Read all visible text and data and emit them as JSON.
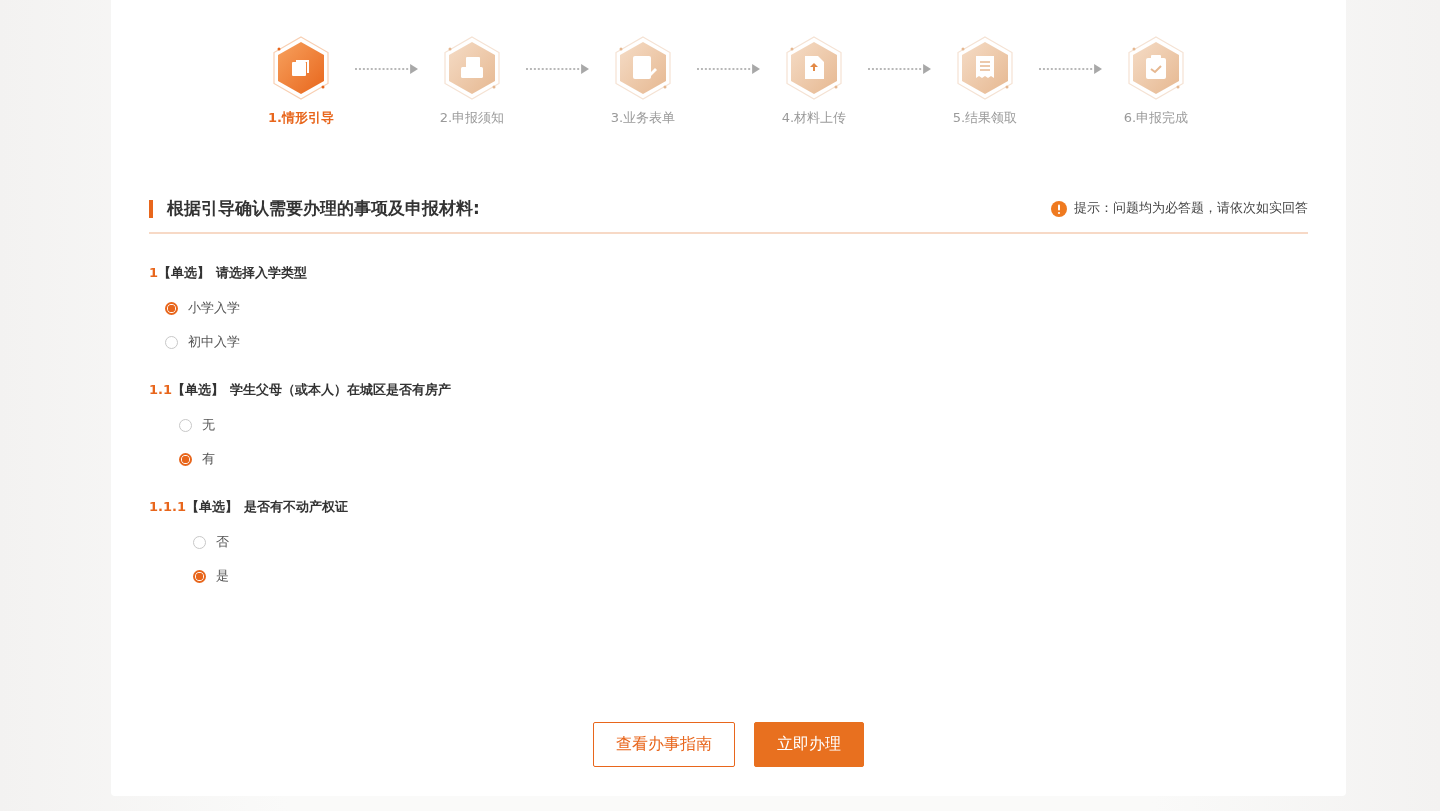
{
  "steps": [
    {
      "label": "1.情形引导",
      "kind": "stack",
      "selected": true
    },
    {
      "label": "2.申报须知",
      "kind": "inbox",
      "selected": false
    },
    {
      "label": "3.业务表单",
      "kind": "form",
      "selected": false
    },
    {
      "label": "4.材料上传",
      "kind": "upload",
      "selected": false
    },
    {
      "label": "5.结果领取",
      "kind": "receipt",
      "selected": false
    },
    {
      "label": "6.申报完成",
      "kind": "clipboard",
      "selected": false
    }
  ],
  "section": {
    "title": "根据引导确认需要办理的事项及申报材料:",
    "hint": "提示：问题均为必答题，请依次如实回答"
  },
  "questions": [
    {
      "number": "1",
      "type": "【单选】",
      "text": "请选择入学类型",
      "options": [
        {
          "label": "小学入学",
          "selected": true
        },
        {
          "label": "初中入学",
          "selected": false
        }
      ],
      "children": [
        {
          "number": "1.1",
          "type": "【单选】",
          "text": "学生父母（或本人）在城区是否有房产",
          "options": [
            {
              "label": "无",
              "selected": false
            },
            {
              "label": "有",
              "selected": true
            }
          ],
          "children": [
            {
              "number": "1.1.1",
              "type": "【单选】",
              "text": "是否有不动产权证",
              "options": [
                {
                  "label": "否",
                  "selected": false
                },
                {
                  "label": "是",
                  "selected": true
                }
              ]
            }
          ]
        }
      ]
    }
  ],
  "buttons": [
    {
      "label": "查看办事指南",
      "kind": "outline"
    },
    {
      "label": "立即办理",
      "kind": "primary"
    }
  ]
}
